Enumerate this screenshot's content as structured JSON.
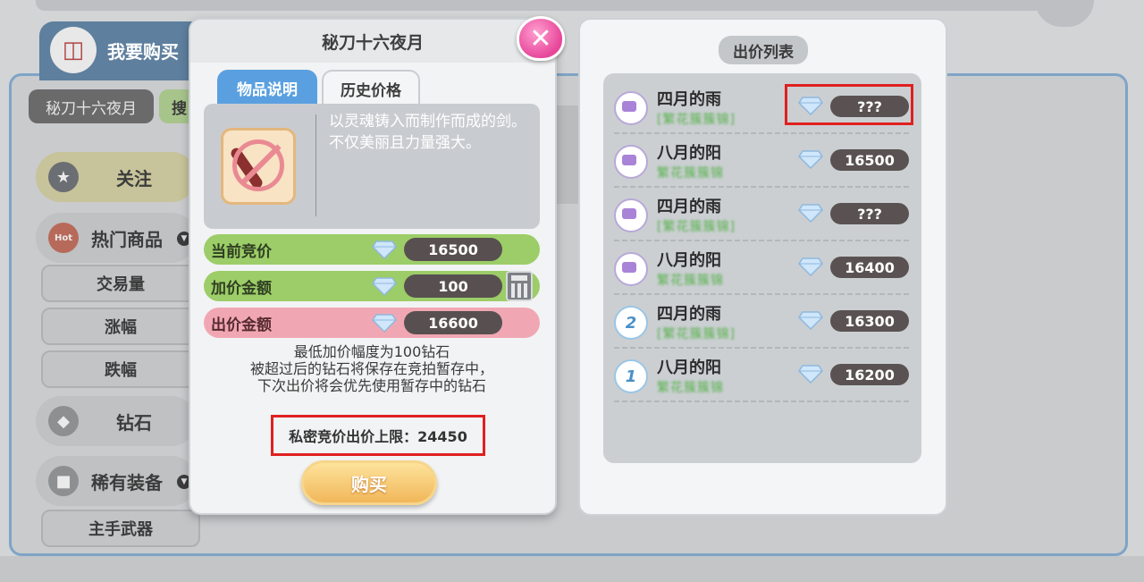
{
  "background": {
    "shop_tab_label": "我要购买",
    "cart_icon": "shopping-cart-icon",
    "search_value": "秘刀十六夜月",
    "search_button": "搜",
    "sidebar": {
      "follow": "关注",
      "hot": "热门商品",
      "trade_volume": "交易量",
      "rise": "涨幅",
      "fall": "跌幅",
      "diamond": "钻石",
      "rare_equip": "稀有装备",
      "main_weapon": "主手武器",
      "hot_badge": "Hot"
    }
  },
  "item_modal": {
    "title": "秘刀十六夜月",
    "close_icon": "close-icon",
    "tabs": {
      "description": "物品说明",
      "history": "历史价格"
    },
    "description": "以灵魂铸入而制作而成的剑。不仅美丽且力量强大。",
    "rows": {
      "current_bid_label": "当前竞价",
      "current_bid_value": "16500",
      "increment_label": "加价金额",
      "increment_value": "100",
      "offer_label": "出价金额",
      "offer_value": "16600"
    },
    "rules": [
      "最低加价幅度为100钻石",
      "被超过后的钻石将保存在竞拍暂存中，",
      "下次出价将会优先使用暂存中的钻石"
    ],
    "private_limit": "私密竞价出价上限：24450",
    "buy_button": "购买"
  },
  "bid_list": {
    "title": "出价列表",
    "entries": [
      {
        "name": "四月的雨",
        "guild": "[繁花簇簇锦]",
        "value": "???"
      },
      {
        "name": "八月的阳",
        "guild": "繁花簇簇锦",
        "value": "16500"
      },
      {
        "name": "四月的雨",
        "guild": "[繁花簇簇锦]",
        "value": "???"
      },
      {
        "name": "八月的阳",
        "guild": "繁花簇簇锦",
        "value": "16400"
      },
      {
        "name": "四月的雨",
        "guild": "[繁花簇簇锦]",
        "value": "16300",
        "rank": "2"
      },
      {
        "name": "八月的阳",
        "guild": "繁花簇簇锦",
        "value": "16200",
        "rank": "1"
      }
    ]
  },
  "colors": {
    "highlight": "#e02020",
    "accent_blue": "#5aa0e0",
    "green_row": "#9ccd68",
    "pink_row": "#f1a7b3"
  }
}
